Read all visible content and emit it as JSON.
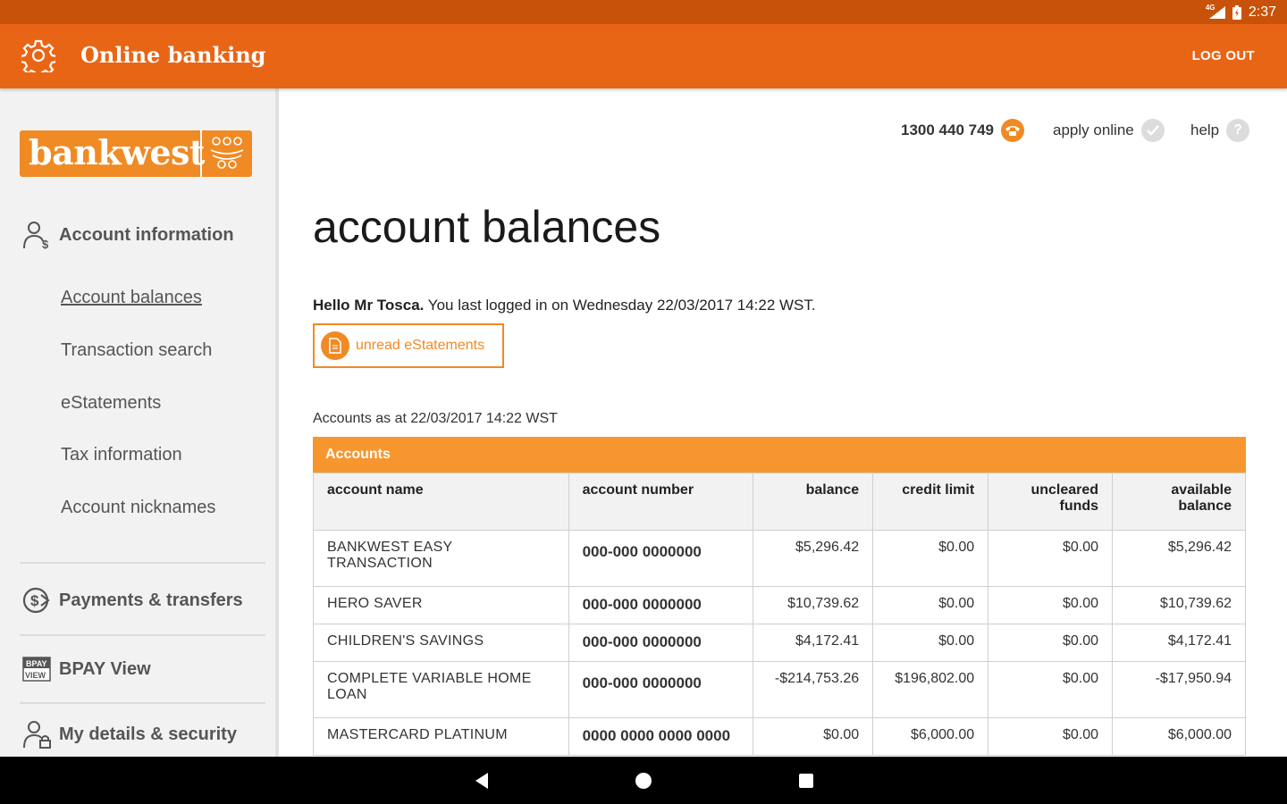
{
  "status_bar": {
    "network": "4G",
    "time": "2:37"
  },
  "app_bar": {
    "title": "Online banking",
    "logout_label": "LOG OUT"
  },
  "sidebar": {
    "logo_text": "bankwest",
    "sections": [
      {
        "label": "Account information",
        "icon": "person-dollar-icon"
      },
      {
        "label": "Payments & transfers",
        "icon": "dollar-arrow-icon"
      },
      {
        "label": "BPAY View",
        "icon": "bpay-view-icon"
      },
      {
        "label": "My details & security",
        "icon": "person-lock-icon"
      }
    ],
    "sub_items": [
      "Account balances",
      "Transaction search",
      "eStatements",
      "Tax information",
      "Account nicknames"
    ]
  },
  "utility": {
    "phone": "1300 440 749",
    "apply": "apply online",
    "help": "help"
  },
  "main": {
    "title": "account balances",
    "hello_name": "Hello Mr Tosca.",
    "hello_rest": " You last logged in on Wednesday 22/03/2017 14:22 WST.",
    "estatements_label": "unread eStatements",
    "as_at": "Accounts as at 22/03/2017 14:22 WST"
  },
  "accounts": {
    "heading": "Accounts",
    "columns": [
      "account name",
      "account number",
      "balance",
      "credit limit",
      "uncleared funds",
      "available balance"
    ],
    "rows": [
      {
        "name": "BANKWEST EASY TRANSACTION",
        "number": "000-000 0000000",
        "balance": "$5,296.42",
        "credit_limit": "$0.00",
        "uncleared": "$0.00",
        "available": "$5,296.42"
      },
      {
        "name": "HERO SAVER",
        "number": "000-000 0000000",
        "balance": "$10,739.62",
        "credit_limit": "$0.00",
        "uncleared": "$0.00",
        "available": "$10,739.62"
      },
      {
        "name": "CHILDREN'S SAVINGS",
        "number": "000-000 0000000",
        "balance": "$4,172.41",
        "credit_limit": "$0.00",
        "uncleared": "$0.00",
        "available": "$4,172.41"
      },
      {
        "name": "COMPLETE VARIABLE HOME LOAN",
        "number": "000-000 0000000",
        "balance": "-$214,753.26",
        "credit_limit": "$196,802.00",
        "uncleared": "$0.00",
        "available": "-$17,950.94"
      },
      {
        "name": "MASTERCARD PLATINUM",
        "number": "0000 0000 0000 0000",
        "balance": "$0.00",
        "credit_limit": "$6,000.00",
        "uncleared": "$0.00",
        "available": "$6,000.00"
      }
    ]
  },
  "colors": {
    "brand_orange": "#e96516",
    "status_bar": "#c9520a",
    "accent": "#f08a24"
  }
}
